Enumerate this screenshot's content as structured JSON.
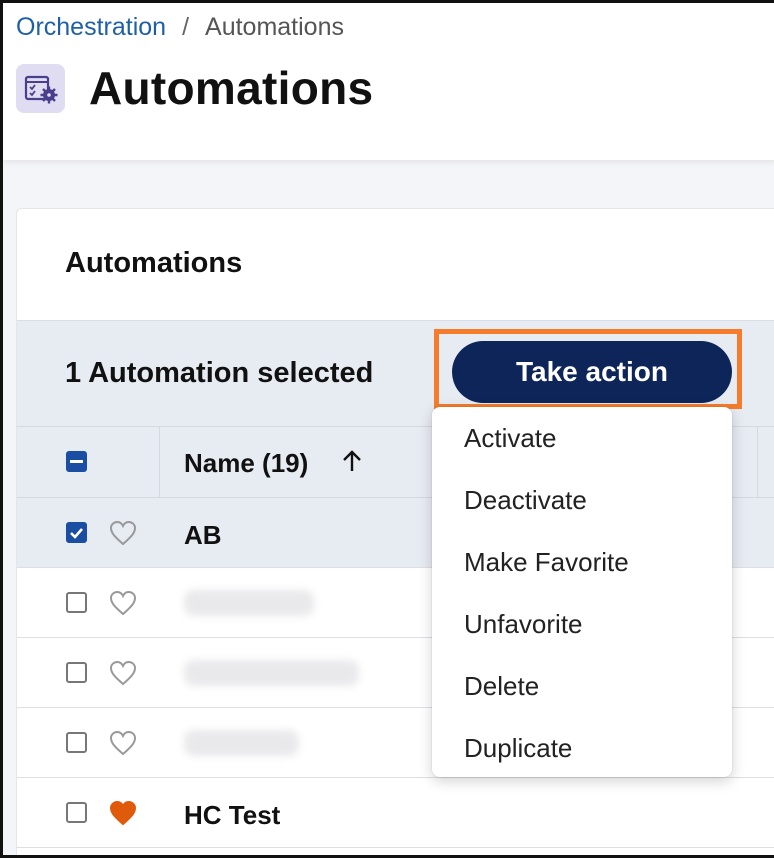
{
  "breadcrumb": {
    "parent": "Orchestration",
    "separator": "/",
    "current": "Automations"
  },
  "page": {
    "title": "Automations",
    "icon": "automation-settings-icon"
  },
  "card": {
    "title": "Automations"
  },
  "bulk": {
    "selection_text": "1 Automation selected",
    "action_label": "Take action"
  },
  "table": {
    "name_header": "Name (19)",
    "sort": "ascending",
    "rows": [
      {
        "name": "AB",
        "selected": true,
        "favorite": false
      },
      {
        "name": "",
        "selected": false,
        "favorite": false
      },
      {
        "name": "",
        "selected": false,
        "favorite": false
      },
      {
        "name": "",
        "selected": false,
        "favorite": false
      },
      {
        "name": "HC Test",
        "selected": false,
        "favorite": true
      }
    ]
  },
  "menu": {
    "items": [
      "Activate",
      "Deactivate",
      "Make Favorite",
      "Unfavorite",
      "Delete",
      "Duplicate"
    ]
  },
  "colors": {
    "accent": "#0e2559",
    "highlight": "#f47c2c",
    "checkbox": "#1a4ea3",
    "favorite": "#e05a0c",
    "link": "#1f5fa8"
  }
}
